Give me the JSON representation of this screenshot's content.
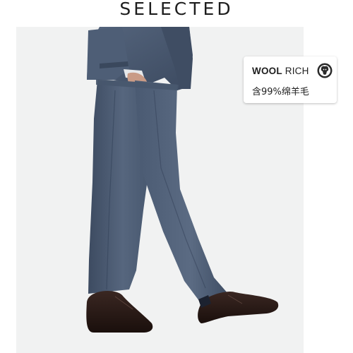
{
  "brand": {
    "name": "SELECTED"
  },
  "badge": {
    "wool_label": "WOOL",
    "rich_label": "RICH",
    "content_text": "含99%绵羊毛",
    "logo_icon": "sheep-head-icon"
  },
  "colors": {
    "background": "#ffffff",
    "photo_background": "#f1f2f2",
    "suit": "#4a5a72",
    "shoe": "#2a1a16"
  }
}
